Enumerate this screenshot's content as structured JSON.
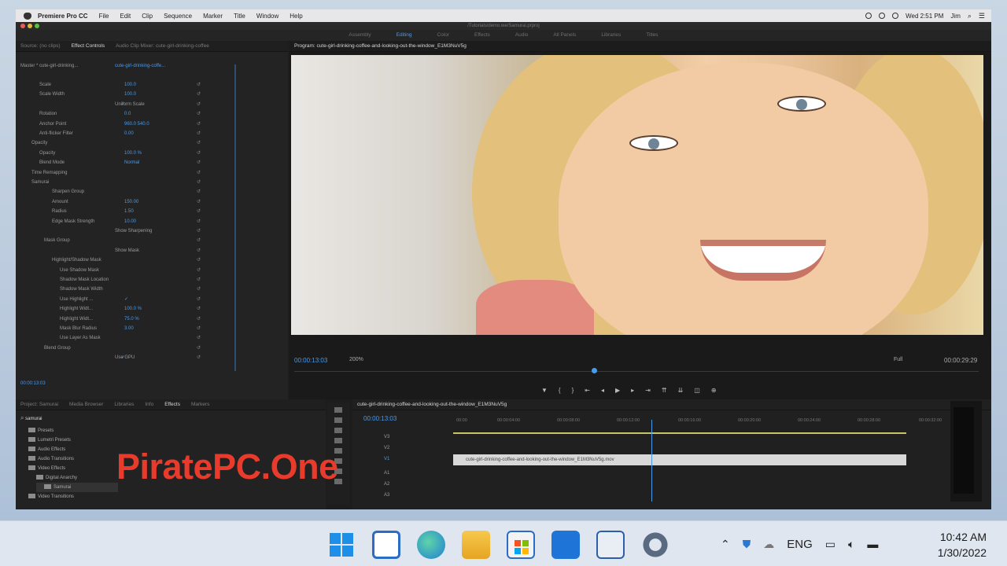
{
  "mac_menu": {
    "app": "Premiere Pro CC",
    "items": [
      "File",
      "Edit",
      "Clip",
      "Sequence",
      "Marker",
      "Title",
      "Window",
      "Help"
    ],
    "clock": "Wed 2:51 PM",
    "user": "Jim"
  },
  "window_title": "/Tutorials/demo.we/Samurai.prproj",
  "workspaces": [
    "Assembly",
    "Editing",
    "Color",
    "Effects",
    "Audio",
    "All Panels",
    "Libraries",
    "Titles"
  ],
  "workspace_active": "Editing",
  "left_panel": {
    "tabs": [
      "Source: (no clips)",
      "Effect Controls",
      "Audio Clip Mixer: cute-girl-drinking-coffee"
    ],
    "active_tab": "Effect Controls",
    "master": "Master * cute-girl-drinking...",
    "clip": "cute-girl-drinking-coffe...",
    "rows": [
      {
        "label": "Scale",
        "value": "100.0"
      },
      {
        "label": "Scale Width",
        "value": "100.0"
      },
      {
        "label": "Uniform Scale",
        "value": "✓"
      },
      {
        "label": "Rotation",
        "value": "0.0"
      },
      {
        "label": "Anchor Point",
        "value": "960.0   540.0"
      },
      {
        "label": "Anti-flicker Filter",
        "value": "0.00"
      },
      {
        "label": "Opacity",
        "value": ""
      },
      {
        "label": "Opacity",
        "value": "100.0 %"
      },
      {
        "label": "Blend Mode",
        "value": "Normal"
      },
      {
        "label": "Time Remapping",
        "value": ""
      },
      {
        "label": "Samurai",
        "value": ""
      },
      {
        "label": "Sharpen Group",
        "value": ""
      },
      {
        "label": "Amount",
        "value": "150.00"
      },
      {
        "label": "Radius",
        "value": "1.50"
      },
      {
        "label": "Edge Mask Strength",
        "value": "10.00"
      },
      {
        "label": "Show Sharpening",
        "value": ""
      },
      {
        "label": "Mask Group",
        "value": ""
      },
      {
        "label": "Show Mask",
        "value": ""
      },
      {
        "label": "Highlight/Shadow Mask",
        "value": ""
      },
      {
        "label": "Use Shadow Mask",
        "value": ""
      },
      {
        "label": "Shadow Mask Location",
        "value": ""
      },
      {
        "label": "Shadow Mask Width",
        "value": ""
      },
      {
        "label": "Use Highlight ...",
        "value": "✓"
      },
      {
        "label": "Highlight Widt...",
        "value": "100.0 %"
      },
      {
        "label": "Highlight Widt...",
        "value": "75.0 %"
      },
      {
        "label": "Mask Blur Radius",
        "value": "3.00"
      },
      {
        "label": "Use Layer As Mask",
        "value": ""
      },
      {
        "label": "Blend Group",
        "value": ""
      },
      {
        "label": "Use GPU",
        "value": "✓"
      }
    ],
    "timecode": "00:00:13:03"
  },
  "program": {
    "tab": "Program: cute-girl-drinking-coffee-and-looking-out-the-window_E1M3NuV5g",
    "timecode_left": "00:00:13:03",
    "zoom": "200%",
    "resolution": "Full",
    "timecode_right": "00:00:29:29"
  },
  "project_panel": {
    "tabs": [
      "Project: Samurai",
      "Media Browser",
      "Libraries",
      "Info",
      "Effects",
      "Markers"
    ],
    "active_tab": "Effects",
    "search": "samurai",
    "items": [
      "Presets",
      "Lumetri Presets",
      "Audio Effects",
      "Audio Transitions",
      "Video Effects",
      "Digital Anarchy",
      "Samurai",
      "Video Transitions"
    ]
  },
  "timeline": {
    "sequence": "cute-girl-drinking-coffee-and-looking-out-the-window_E1M3NuV5g",
    "timecode": "00:00:13:03",
    "ruler": [
      "00:00",
      "00:00:04:00",
      "00:00:08:00",
      "00:00:12:00",
      "00:00:16:00",
      "00:00:20:00",
      "00:00:24:00",
      "00:00:28:00",
      "00:00:32:00"
    ],
    "tracks": [
      "V3",
      "V2",
      "V1",
      "A1",
      "A2",
      "A3"
    ],
    "clip": "cute-girl-drinking-coffee-and-looking-out-the-window_E1M3NuV5g.mov"
  },
  "watermark": "PiratePC.One",
  "taskbar": {
    "apps": [
      "start-icon",
      "widgets-icon",
      "edge-icon",
      "file-explorer-icon",
      "store-icon",
      "mail-icon",
      "notepad-icon",
      "settings-icon"
    ],
    "lang": "ENG",
    "time": "10:42 AM",
    "date": "1/30/2022"
  }
}
